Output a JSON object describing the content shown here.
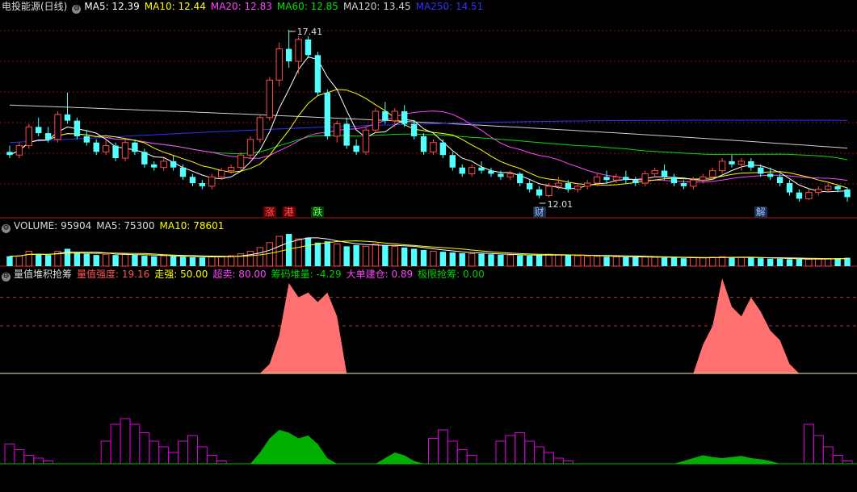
{
  "colors": {
    "up": "#ff4a4a",
    "down": "#54ffff",
    "ma5": "#ffffff",
    "ma10": "#ffff00",
    "ma20": "#ff44ff",
    "ma60": "#00e000",
    "ma120": "#d0d0d0",
    "ma250": "#3030ff",
    "grid": "#8a1515",
    "qiangdu": "#ff7070",
    "magenta": "#e000e0",
    "green": "#00b000"
  },
  "header_main": {
    "title": "电投能源(日线)",
    "items": [
      {
        "label": "MA5: 12.39",
        "color": "#ffffff"
      },
      {
        "label": "MA10: 12.44",
        "color": "#ffff00"
      },
      {
        "label": "MA20: 12.83",
        "color": "#ff44ff"
      },
      {
        "label": "MA60: 12.85",
        "color": "#00e000"
      },
      {
        "label": "MA120: 13.45",
        "color": "#d0d0d0"
      },
      {
        "label": "MA250: 14.51",
        "color": "#3030ff"
      }
    ]
  },
  "header_volume": {
    "items": [
      {
        "label": "VOLUME: 95904",
        "color": "#dddddd"
      },
      {
        "label": "MA5: 75300",
        "color": "#dddddd"
      },
      {
        "label": "MA10: 78601",
        "color": "#ffff00"
      }
    ]
  },
  "header_indicator": {
    "title": "量值堆积抢筹",
    "items": [
      {
        "label": "量值强度: 19.16",
        "color": "#ff5555"
      },
      {
        "label": "走强: 50.00",
        "color": "#ffff00"
      },
      {
        "label": "超卖: 80.00",
        "color": "#ff44ff"
      },
      {
        "label": "筹码堆量: -4.29",
        "color": "#00d000"
      },
      {
        "label": "大单建仓: 0.89",
        "color": "#ff44ff"
      },
      {
        "label": "极限抢筹: 0.00",
        "color": "#00d000"
      }
    ]
  },
  "events": [
    {
      "text": "涨",
      "bg": "#6a0000",
      "color": "#ff5a5a",
      "day": 27
    },
    {
      "text": "港",
      "bg": "#6a0000",
      "color": "#ff5a5a",
      "day": 29
    },
    {
      "text": "跌",
      "bg": "#004000",
      "color": "#66ff66",
      "day": 32
    },
    {
      "text": "财",
      "bg": "#203050",
      "color": "#a0c0ff",
      "day": 55
    },
    {
      "text": "解",
      "bg": "#203050",
      "color": "#a0c0ff",
      "day": 78
    }
  ],
  "annotations": [
    {
      "text": "17.41",
      "day": 29
    },
    {
      "text": "12.01",
      "day": 55
    }
  ],
  "chart_data": [
    {
      "type": "candlestick",
      "ylim": [
        11.7,
        17.9
      ],
      "days": 88,
      "ohlc": [
        [
          13.5,
          13.7,
          13.3,
          13.4
        ],
        [
          13.4,
          13.8,
          13.3,
          13.7
        ],
        [
          13.7,
          14.4,
          13.6,
          14.3
        ],
        [
          14.3,
          14.6,
          14.0,
          14.1
        ],
        [
          14.1,
          14.3,
          13.8,
          13.9
        ],
        [
          13.9,
          14.8,
          13.8,
          14.7
        ],
        [
          14.7,
          15.4,
          14.4,
          14.5
        ],
        [
          14.5,
          14.6,
          13.9,
          14.0
        ],
        [
          14.0,
          14.2,
          13.7,
          13.8
        ],
        [
          13.8,
          13.9,
          13.4,
          13.5
        ],
        [
          13.5,
          13.9,
          13.4,
          13.7
        ],
        [
          13.7,
          13.8,
          13.2,
          13.3
        ],
        [
          13.3,
          13.9,
          13.2,
          13.8
        ],
        [
          13.8,
          13.9,
          13.4,
          13.5
        ],
        [
          13.5,
          13.6,
          13.0,
          13.1
        ],
        [
          13.1,
          13.2,
          12.9,
          13.0
        ],
        [
          13.0,
          13.3,
          12.9,
          13.2
        ],
        [
          13.2,
          13.4,
          12.9,
          13.0
        ],
        [
          13.0,
          13.1,
          12.6,
          12.7
        ],
        [
          12.7,
          12.8,
          12.4,
          12.5
        ],
        [
          12.5,
          12.6,
          12.3,
          12.4
        ],
        [
          12.4,
          12.8,
          12.3,
          12.7
        ],
        [
          12.7,
          13.0,
          12.6,
          12.9
        ],
        [
          12.9,
          13.1,
          12.8,
          13.0
        ],
        [
          13.0,
          13.5,
          12.9,
          13.4
        ],
        [
          13.4,
          14.0,
          13.3,
          13.9
        ],
        [
          13.9,
          14.7,
          13.8,
          14.6
        ],
        [
          14.6,
          15.9,
          14.5,
          15.8
        ],
        [
          15.8,
          17.0,
          15.6,
          16.8
        ],
        [
          16.8,
          17.41,
          16.2,
          16.4
        ],
        [
          16.4,
          17.2,
          16.0,
          17.1
        ],
        [
          17.1,
          17.2,
          16.5,
          16.6
        ],
        [
          16.6,
          16.7,
          15.3,
          15.4
        ],
        [
          15.4,
          15.5,
          13.9,
          14.0
        ],
        [
          14.0,
          14.5,
          13.8,
          14.4
        ],
        [
          14.4,
          14.6,
          13.6,
          13.7
        ],
        [
          13.7,
          13.9,
          13.4,
          13.5
        ],
        [
          13.5,
          14.3,
          13.4,
          14.2
        ],
        [
          14.2,
          14.9,
          14.1,
          14.8
        ],
        [
          14.8,
          15.1,
          14.4,
          14.5
        ],
        [
          14.5,
          14.9,
          14.3,
          14.8
        ],
        [
          14.8,
          15.0,
          14.3,
          14.4
        ],
        [
          14.4,
          14.5,
          13.9,
          14.0
        ],
        [
          14.0,
          14.1,
          13.4,
          13.5
        ],
        [
          13.5,
          13.9,
          13.4,
          13.8
        ],
        [
          13.8,
          13.9,
          13.3,
          13.4
        ],
        [
          13.4,
          13.5,
          12.9,
          13.0
        ],
        [
          13.0,
          13.1,
          12.7,
          12.8
        ],
        [
          12.8,
          13.1,
          12.7,
          13.0
        ],
        [
          13.0,
          13.2,
          12.8,
          12.9
        ],
        [
          12.9,
          13.0,
          12.7,
          12.8
        ],
        [
          12.8,
          12.9,
          12.6,
          12.7
        ],
        [
          12.7,
          12.9,
          12.6,
          12.8
        ],
        [
          12.8,
          12.85,
          12.4,
          12.5
        ],
        [
          12.5,
          12.6,
          12.2,
          12.3
        ],
        [
          12.3,
          12.4,
          12.01,
          12.1
        ],
        [
          12.1,
          12.5,
          12.05,
          12.4
        ],
        [
          12.4,
          12.7,
          12.3,
          12.5
        ],
        [
          12.5,
          12.6,
          12.2,
          12.3
        ],
        [
          12.3,
          12.5,
          12.2,
          12.4
        ],
        [
          12.4,
          12.6,
          12.3,
          12.5
        ],
        [
          12.5,
          12.8,
          12.4,
          12.7
        ],
        [
          12.7,
          12.9,
          12.5,
          12.6
        ],
        [
          12.6,
          12.8,
          12.5,
          12.7
        ],
        [
          12.7,
          12.9,
          12.5,
          12.6
        ],
        [
          12.6,
          12.7,
          12.4,
          12.5
        ],
        [
          12.5,
          12.9,
          12.4,
          12.8
        ],
        [
          12.8,
          13.0,
          12.7,
          12.9
        ],
        [
          12.9,
          13.1,
          12.6,
          12.7
        ],
        [
          12.7,
          12.8,
          12.4,
          12.5
        ],
        [
          12.5,
          12.6,
          12.3,
          12.4
        ],
        [
          12.4,
          12.7,
          12.3,
          12.6
        ],
        [
          12.6,
          12.8,
          12.5,
          12.7
        ],
        [
          12.7,
          13.0,
          12.6,
          12.9
        ],
        [
          12.9,
          13.3,
          12.8,
          13.2
        ],
        [
          13.2,
          13.4,
          13.0,
          13.1
        ],
        [
          13.1,
          13.3,
          12.9,
          13.2
        ],
        [
          13.2,
          13.3,
          12.9,
          13.0
        ],
        [
          13.0,
          13.1,
          12.7,
          12.8
        ],
        [
          12.8,
          13.0,
          12.6,
          12.7
        ],
        [
          12.7,
          12.8,
          12.4,
          12.5
        ],
        [
          12.5,
          12.6,
          12.1,
          12.2
        ],
        [
          12.2,
          12.3,
          11.9,
          12.0
        ],
        [
          12.0,
          12.3,
          11.95,
          12.2
        ],
        [
          12.2,
          12.4,
          12.1,
          12.3
        ],
        [
          12.3,
          12.5,
          12.2,
          12.4
        ],
        [
          12.4,
          12.45,
          12.2,
          12.3
        ],
        [
          12.3,
          12.35,
          11.9,
          12.05
        ]
      ],
      "ma_lines": [
        {
          "name": "MA120",
          "values_start": 15.0,
          "values_end": 13.5
        },
        {
          "name": "MA250",
          "values_start": 13.8,
          "values_end": 14.5
        }
      ]
    },
    {
      "type": "bar",
      "name": "VOLUME",
      "values": [
        40,
        42,
        60,
        50,
        45,
        60,
        70,
        55,
        50,
        45,
        48,
        45,
        50,
        45,
        42,
        40,
        42,
        40,
        38,
        36,
        35,
        38,
        40,
        42,
        50,
        60,
        75,
        95,
        120,
        130,
        110,
        115,
        95,
        100,
        90,
        80,
        85,
        80,
        90,
        85,
        80,
        75,
        70,
        65,
        60,
        58,
        55,
        52,
        50,
        50,
        48,
        46,
        45,
        44,
        42,
        45,
        48,
        46,
        44,
        42,
        40,
        40,
        38,
        38,
        36,
        36,
        38,
        36,
        34,
        34,
        32,
        34,
        34,
        36,
        38,
        36,
        36,
        34,
        32,
        30,
        30,
        28,
        28,
        28,
        30,
        30,
        32,
        34
      ]
    },
    {
      "type": "area",
      "name": "量值强度",
      "reference_lines": [
        50,
        80
      ],
      "values": [
        0,
        0,
        0,
        0,
        0,
        0,
        0,
        0,
        0,
        0,
        0,
        0,
        0,
        0,
        0,
        0,
        0,
        0,
        0,
        0,
        0,
        0,
        0,
        0,
        0,
        0,
        0,
        10,
        40,
        95,
        80,
        85,
        75,
        85,
        60,
        0,
        0,
        0,
        0,
        0,
        0,
        0,
        0,
        0,
        0,
        0,
        0,
        0,
        0,
        0,
        0,
        0,
        0,
        0,
        0,
        0,
        0,
        0,
        0,
        0,
        0,
        0,
        0,
        0,
        0,
        0,
        0,
        0,
        0,
        0,
        0,
        0,
        30,
        50,
        100,
        70,
        60,
        80,
        65,
        45,
        35,
        10,
        0,
        0,
        0,
        0,
        0,
        0
      ]
    },
    {
      "type": "area",
      "name": "筹码堆量",
      "values": [
        0,
        0,
        0,
        0,
        0,
        0,
        0,
        0,
        0,
        0,
        0,
        0,
        0,
        0,
        0,
        0,
        0,
        0,
        0,
        0,
        0,
        0,
        0,
        0,
        0,
        0,
        20,
        45,
        60,
        55,
        45,
        50,
        35,
        10,
        0,
        0,
        0,
        0,
        0,
        10,
        20,
        15,
        5,
        0,
        0,
        0,
        0,
        0,
        0,
        0,
        0,
        0,
        0,
        0,
        0,
        0,
        0,
        0,
        0,
        0,
        0,
        0,
        0,
        0,
        0,
        0,
        0,
        0,
        0,
        0,
        5,
        10,
        15,
        12,
        10,
        12,
        14,
        10,
        8,
        5,
        0,
        0,
        0,
        0,
        0,
        0,
        0,
        0
      ]
    },
    {
      "type": "bar",
      "name": "大单建仓",
      "values": [
        35,
        25,
        15,
        10,
        5,
        0,
        0,
        0,
        0,
        0,
        40,
        70,
        80,
        70,
        55,
        40,
        30,
        20,
        40,
        50,
        30,
        15,
        5,
        0,
        0,
        0,
        0,
        0,
        0,
        0,
        0,
        0,
        0,
        0,
        0,
        0,
        0,
        0,
        0,
        0,
        0,
        0,
        0,
        0,
        45,
        60,
        40,
        25,
        15,
        0,
        0,
        40,
        50,
        55,
        40,
        30,
        20,
        10,
        5,
        0,
        0,
        0,
        0,
        0,
        0,
        0,
        0,
        0,
        0,
        0,
        0,
        0,
        0,
        0,
        0,
        0,
        0,
        0,
        0,
        0,
        0,
        0,
        0,
        70,
        50,
        30,
        15,
        5
      ]
    }
  ]
}
